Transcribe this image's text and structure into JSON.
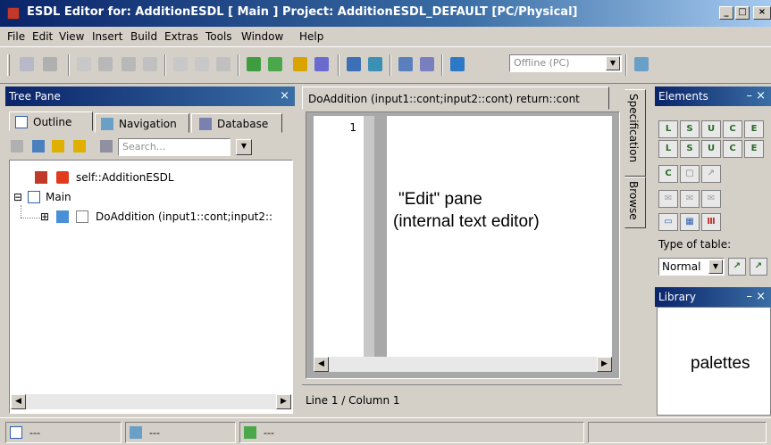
{
  "window": {
    "title": "ESDL Editor for: AdditionESDL [ Main ] Project: AdditionESDL_DEFAULT [PC/Physical]",
    "minimize": "_",
    "maximize": "□",
    "close": "×"
  },
  "menu": [
    "File",
    "Edit",
    "View",
    "Insert",
    "Build",
    "Extras",
    "Tools",
    "Window",
    "Help"
  ],
  "toolbar": {
    "mode_select": "Offline (PC)"
  },
  "tree_pane": {
    "title": "Tree Pane",
    "close": "×",
    "tabs": [
      "Outline",
      "Navigation",
      "Database"
    ],
    "search_placeholder": "Search...",
    "nodes": {
      "root": "self::AdditionESDL",
      "main": "Main",
      "method": "DoAddition (input1::cont;input2::"
    },
    "expand_main": "⊟",
    "expand_method": "⊞"
  },
  "editor": {
    "tab_label": "DoAddition (input1::cont;input2::cont) return::cont",
    "line_number": "1",
    "status": "Line 1 / Column 1"
  },
  "side_tabs": [
    "Specification",
    "Browse"
  ],
  "elements_pane": {
    "title": "Elements",
    "close": "– ×",
    "type_of_table_label": "Type of table:",
    "type_of_table_value": "Normal"
  },
  "library_pane": {
    "title": "Library",
    "close": "– ×"
  },
  "annotations": {
    "edit_pane_line1": "\"Edit\" pane",
    "edit_pane_line2": "(internal text editor)",
    "palettes": "palettes"
  },
  "statusbar": [
    "---",
    "---",
    "---"
  ],
  "colors": {
    "title_gradient_start": "#0a246a",
    "title_gradient_end": "#a6caf0",
    "face": "#d4d0c8"
  }
}
